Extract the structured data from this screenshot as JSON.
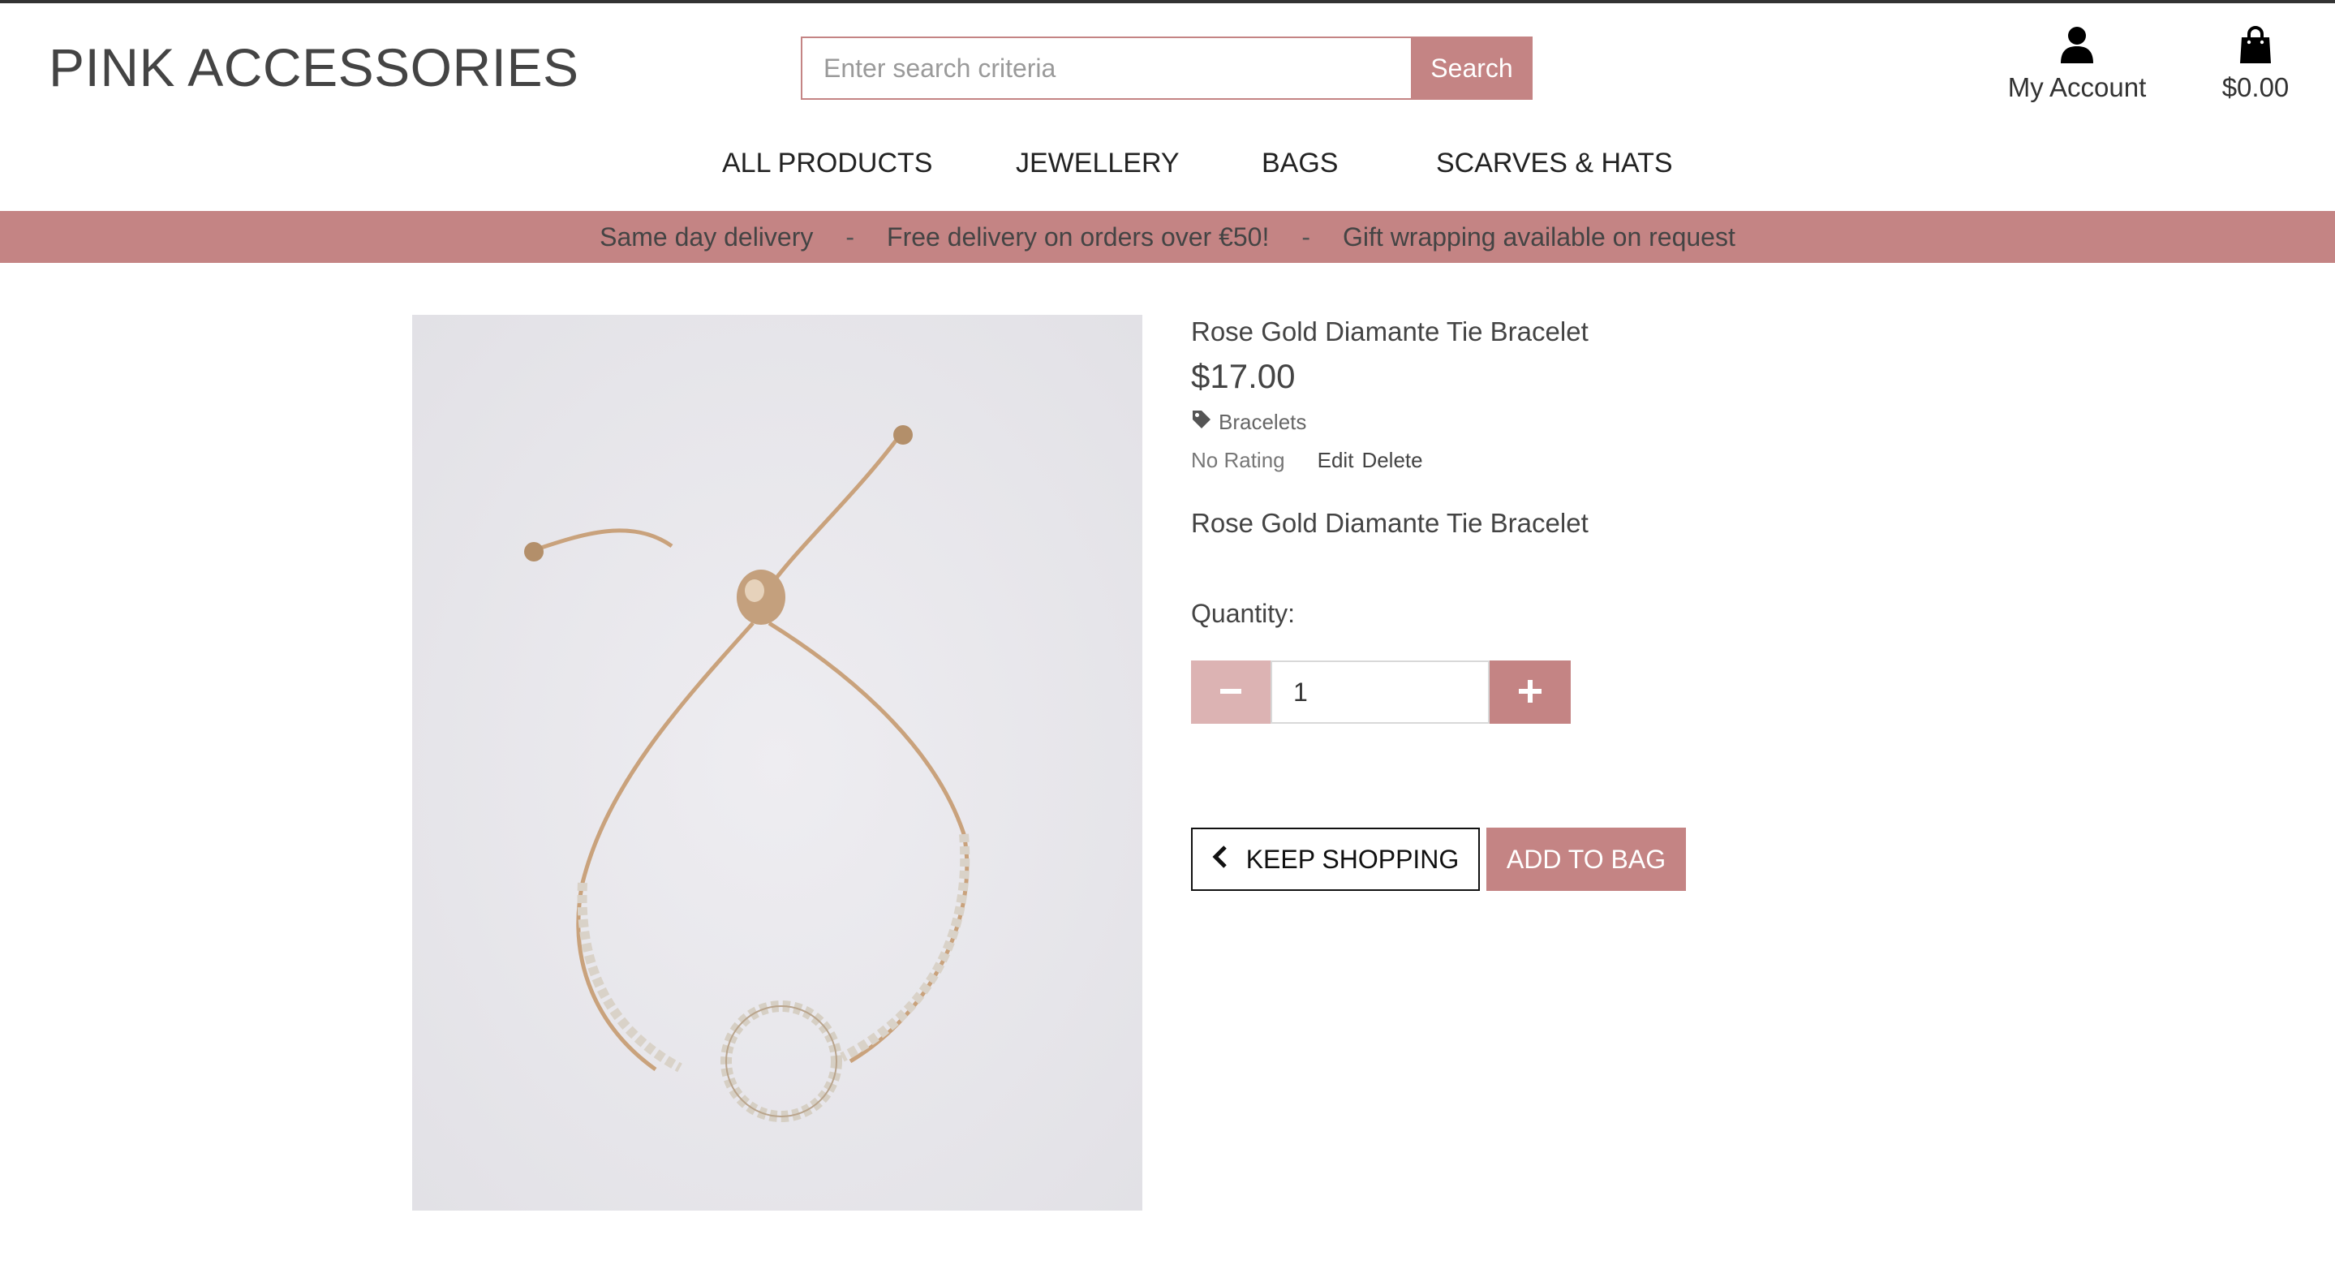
{
  "header": {
    "logo": "PINK ACCESSORIES",
    "search_placeholder": "Enter search criteria",
    "search_button": "Search",
    "account_label": "My Account",
    "bag_total": "$0.00"
  },
  "nav": {
    "items": [
      "ALL PRODUCTS",
      "JEWELLERY",
      "BAGS",
      "SCARVES & HATS"
    ]
  },
  "banner": {
    "messages": [
      "Same day delivery",
      "Free delivery on orders over €50!",
      "Gift wrapping available on request"
    ],
    "separator": "-"
  },
  "product": {
    "name": "Rose Gold Diamante Tie Bracelet",
    "price": "$17.00",
    "category": "Bracelets",
    "rating": "No Rating",
    "edit_label": "Edit",
    "delete_label": "Delete",
    "description": "Rose Gold Diamante Tie Bracelet",
    "quantity_label": "Quantity:",
    "quantity_value": "1"
  },
  "actions": {
    "keep_shopping": "KEEP SHOPPING",
    "add_to_bag": "ADD TO BAG"
  },
  "colors": {
    "accent": "#c48484",
    "accent_light": "#dcb3b3",
    "text": "#444444"
  },
  "icons": {
    "account": "user-icon",
    "bag": "shopping-bag-icon",
    "category": "tag-icon",
    "minus": "minus-icon",
    "plus": "plus-icon",
    "back": "chevron-left-icon"
  }
}
